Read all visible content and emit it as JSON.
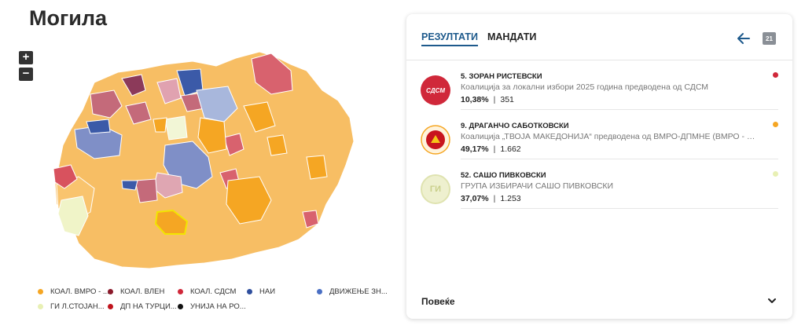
{
  "page": {
    "title": "Могила"
  },
  "zoom": {
    "in_label": "+",
    "out_label": "−"
  },
  "legend": [
    {
      "label": "КОАЛ. ВМРО - ...",
      "color": "#f5a623"
    },
    {
      "label": "КОАЛ. ВЛЕН",
      "color": "#8b1a2b"
    },
    {
      "label": "КОАЛ. СДСМ",
      "color": "#d0283a"
    },
    {
      "label": "НАИ",
      "color": "#2f4f9e"
    },
    {
      "label": "ДВИЖЕЊЕ ЗН...",
      "color": "#4a6fc4"
    },
    {
      "label": "ГИ Л.СТОЈАН...",
      "color": "#e8f0b4"
    },
    {
      "label": "ДП НА ТУРЦИ...",
      "color": "#c0141d"
    },
    {
      "label": "УНИЈА НА РО...",
      "color": "#111111"
    }
  ],
  "panel": {
    "tabs": [
      {
        "label": "РЕЗУЛТАТИ",
        "active": true
      },
      {
        "label": "МАНДАТИ",
        "active": false
      }
    ],
    "back_icon": "arrow-left-icon",
    "calendar_icon": "calendar-icon",
    "calendar_text": "21",
    "candidates": [
      {
        "name": "5. ЗОРАН РИСТЕВСКИ",
        "party": "Коалиција за локални избори 2025 година предводена од СДСМ",
        "percent": "10,38%",
        "votes": "351",
        "logo_text": "СДСМ",
        "logo_color": "#d0283a",
        "dot_color": "#d0283a"
      },
      {
        "name": "9. ДРАГАНЧО САБОТКОВСКИ",
        "party": "Коалиција „ТВОЈА МАКЕДОНИЈА“ предводена од ВМРО-ДПМНЕ (ВМРО - Дем...",
        "percent": "49,17%",
        "votes": "1.662",
        "logo_text": "",
        "logo_color": "#c8141e",
        "dot_color": "#f5a623"
      },
      {
        "name": "52. САШО ПИВКОВСКИ",
        "party": "ГРУПА ИЗБИРАЧИ САШО ПИВКОВСКИ",
        "percent": "37,07%",
        "votes": "1.253",
        "logo_text": "ГИ",
        "logo_color": "#e8ecc0",
        "dot_color": "#e8f0b4"
      }
    ],
    "more_label": "Повеќе"
  }
}
